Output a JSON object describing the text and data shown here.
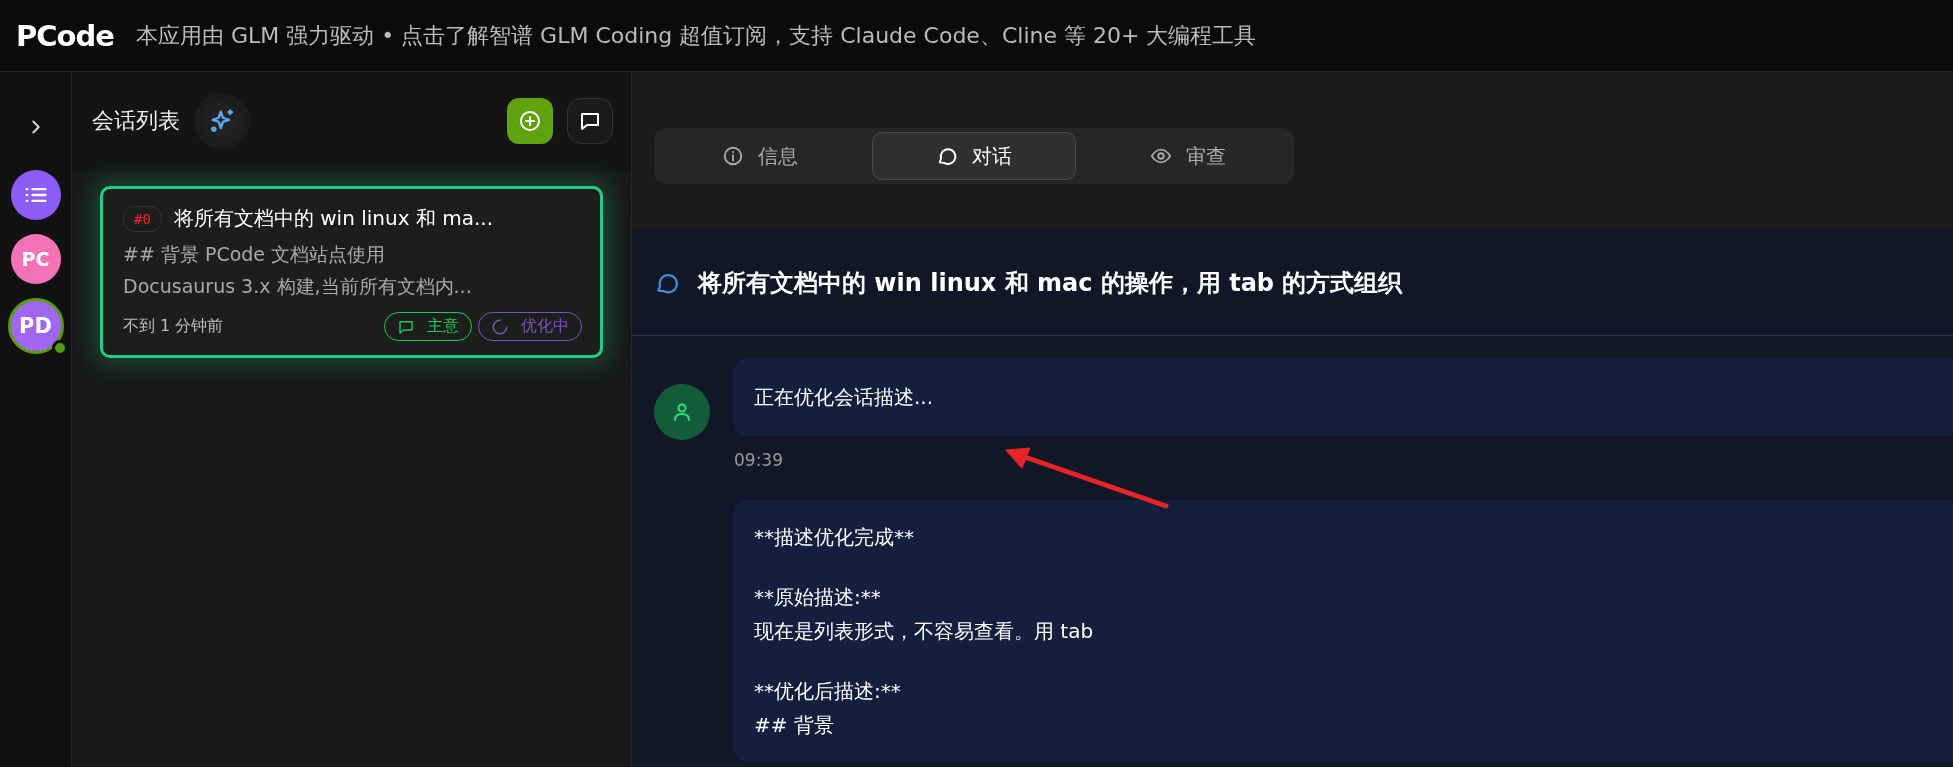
{
  "top_bar": {
    "brand": "PCode",
    "notice": "本应用由 GLM 强力驱动 • 点击了解智谱 GLM Coding 超值订阅，支持 Claude Code、Cline 等 20+ 大编程工具"
  },
  "rail": {
    "items": [
      {
        "kind": "menu",
        "color": "#8b5cf6",
        "selected": false
      },
      {
        "kind": "avatar",
        "label": "PC",
        "color": "#f472b6",
        "selected": false
      },
      {
        "kind": "avatar",
        "label": "PD",
        "color": "#a066f0",
        "selected": true
      }
    ]
  },
  "session_list": {
    "title": "会话列表",
    "sessions": [
      {
        "number": "#0",
        "title": "将所有文档中的 win linux 和 ma...",
        "preview": "## 背景 PCode 文档站点使用 Docusaurus 3.x 构建,当前所有文档内...",
        "time": "不到 1 分钟前",
        "selected": true,
        "tags": [
          {
            "kind": "chat",
            "label": "主意",
            "color": "#22c55e"
          },
          {
            "kind": "loading",
            "label": "优化中",
            "color": "#7b52c4"
          }
        ]
      }
    ]
  },
  "tabs": [
    {
      "kind": "info",
      "label": "信息",
      "selected": false
    },
    {
      "kind": "chat",
      "label": "对话",
      "selected": true
    },
    {
      "kind": "review",
      "label": "审查",
      "selected": false
    }
  ],
  "conversation": {
    "title": "将所有文档中的 win linux 和 mac 的操作，用 tab 的方式组织",
    "messages": [
      {
        "kind": "status",
        "text": "正在优化会话描述...",
        "time": "09:39"
      },
      {
        "kind": "result",
        "paragraphs": [
          [
            "**描述优化完成**"
          ],
          [
            "**原始描述:**",
            "现在是列表形式，不容易查看。用 tab"
          ],
          [
            "**优化后描述:**",
            "## 背景"
          ]
        ]
      }
    ]
  }
}
